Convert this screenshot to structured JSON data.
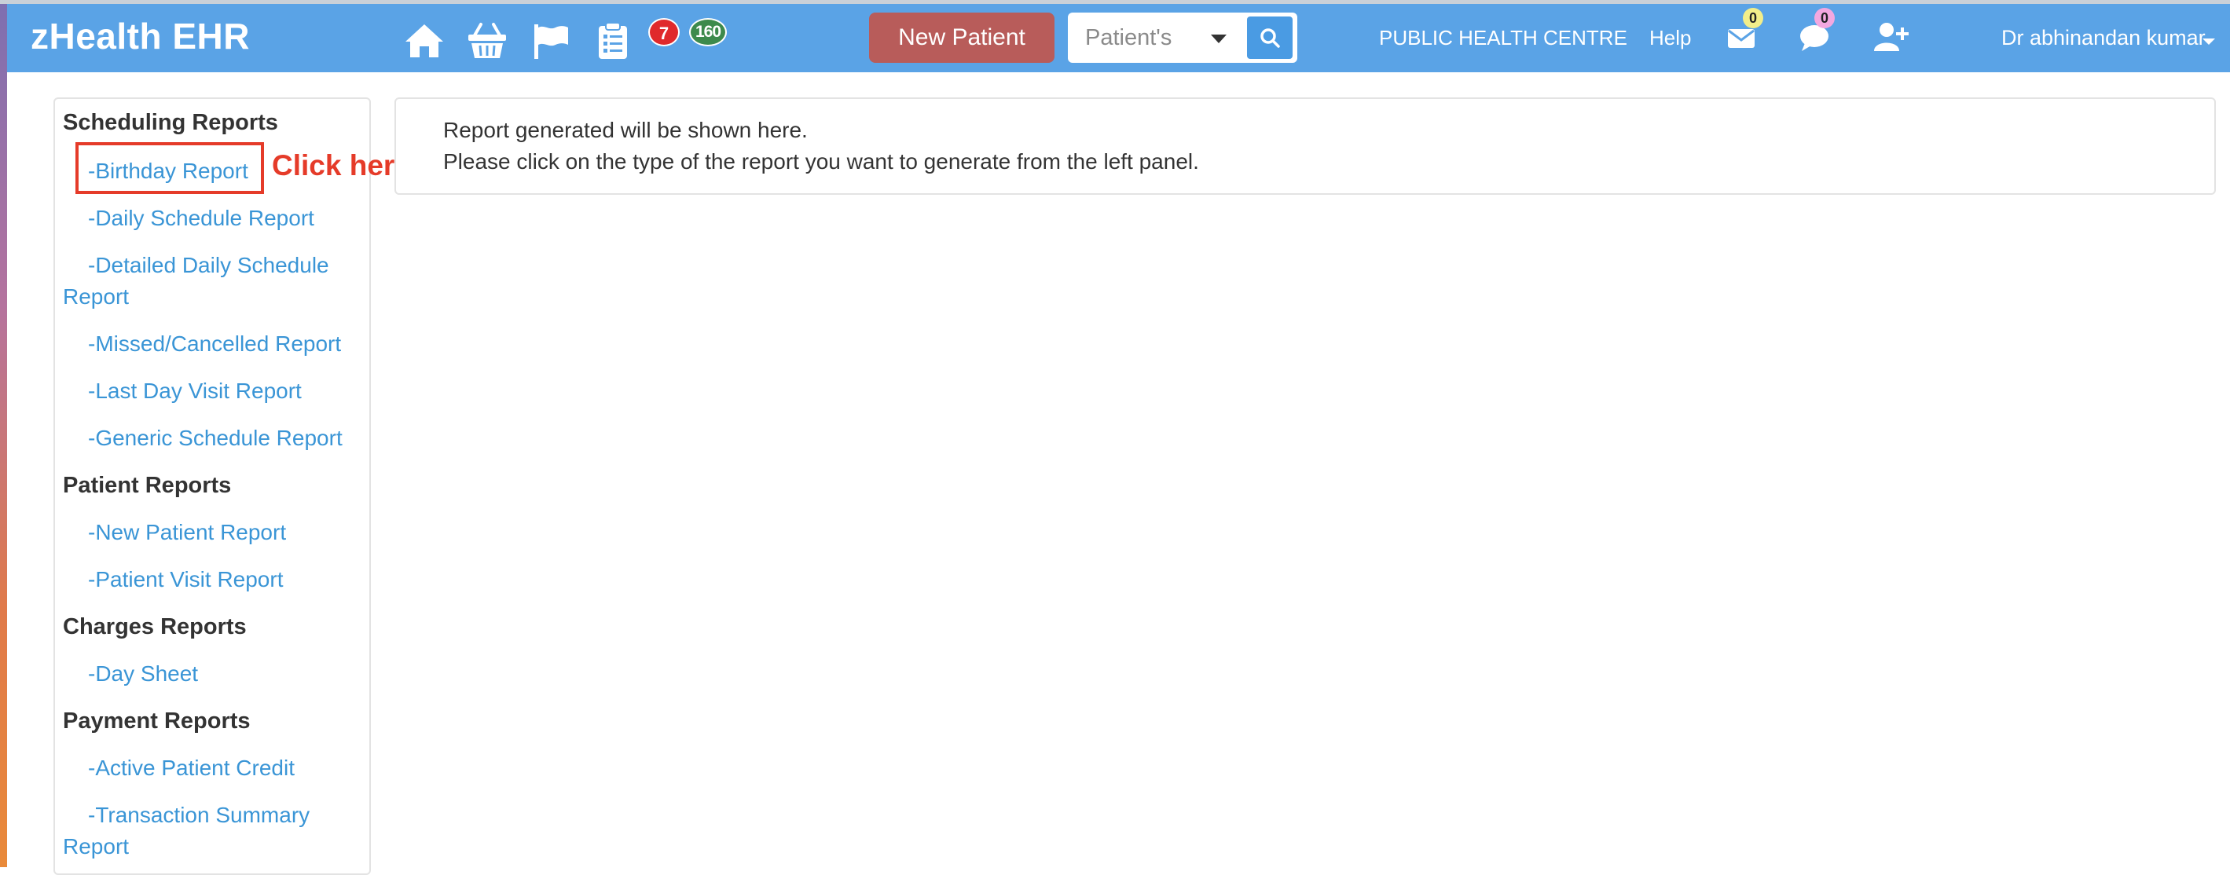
{
  "navbar": {
    "brand": "zHealth EHR",
    "icons": [
      "home-icon",
      "basket-icon",
      "flag-icon",
      "clipboard-icon"
    ],
    "badge_red": "7",
    "badge_green": "160",
    "new_patient_label": "New Patient",
    "search_select_value": "Patient's",
    "facility": "PUBLIC HEALTH CENTRE",
    "help": "Help",
    "mail_count": "0",
    "chat_count": "0",
    "user_name": "Dr abhinandan kumar"
  },
  "colors": {
    "navbar_bg": "#5aa3e6",
    "new_patient_bg": "#b85c5a",
    "link": "#3a95d6",
    "annotation": "#e53b29"
  },
  "sidebar": {
    "sections": [
      {
        "header": "Scheduling Reports",
        "items": [
          "-Birthday Report",
          "-Daily Schedule Report",
          "-Detailed Daily Schedule Report",
          "-Missed/Cancelled Report",
          "-Last Day Visit Report",
          "-Generic Schedule Report"
        ]
      },
      {
        "header": "Patient Reports",
        "items": [
          "-New Patient Report",
          "-Patient Visit Report"
        ]
      },
      {
        "header": "Charges Reports",
        "items": [
          "-Day Sheet"
        ]
      },
      {
        "header": "Payment Reports",
        "items": [
          "-Active Patient Credit",
          "-Transaction Summary Report"
        ]
      }
    ]
  },
  "annotation": {
    "text": "Click here"
  },
  "report_panel": {
    "line1": "Report generated will be shown here.",
    "line2": "Please click on the type of the report you want to generate from the left panel."
  }
}
